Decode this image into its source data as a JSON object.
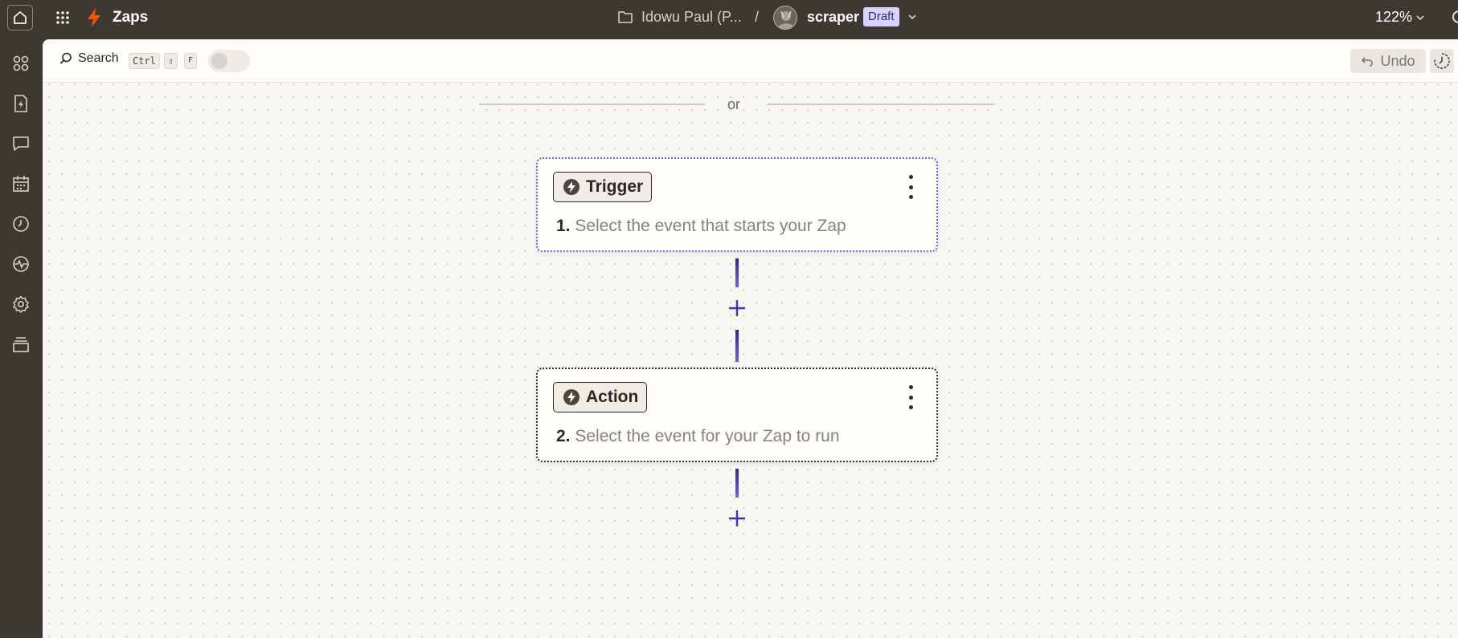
{
  "topbar": {
    "app_title": "Zaps",
    "breadcrumb_owner": "Idowu Paul (P...",
    "breadcrumb_separator": "/",
    "zap_name": "scraper",
    "status_badge": "Draft",
    "zoom_level": "122%"
  },
  "toolbar": {
    "search_label": "Search",
    "shortcut_keys": [
      "Ctrl",
      "⇧",
      "F"
    ],
    "undo_label": "Undo"
  },
  "canvas": {
    "divider_text": "or",
    "steps": [
      {
        "badge": "Trigger",
        "number": "1.",
        "description": "Select the event that starts your Zap"
      },
      {
        "badge": "Action",
        "number": "2.",
        "description": "Select the event for your Zap to run"
      }
    ]
  },
  "colors": {
    "chrome": "#3d3832",
    "accent_bolt": "#ff4f00",
    "trigger_border": "#6b5cf2",
    "connector": "#3b35b5",
    "draft_badge": "#d8d4ff"
  },
  "icons": {
    "sidebar": [
      "apps-icon",
      "zap-file-icon",
      "chat-icon",
      "calendar-icon",
      "history-icon",
      "activity-icon",
      "settings-icon",
      "layers-icon"
    ]
  }
}
